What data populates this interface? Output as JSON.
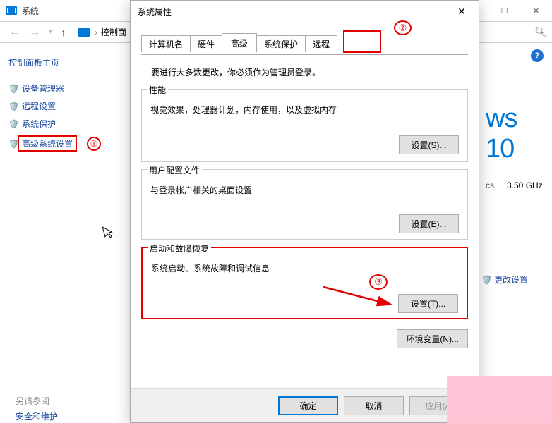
{
  "bg": {
    "title": "系统",
    "breadcrumb": "控制面…",
    "help": "?",
    "wincontrols": {
      "min": "—",
      "max": "☐",
      "close": "✕"
    }
  },
  "leftpanel": {
    "header": "控制面板主页",
    "items": [
      {
        "label": "设备管理器"
      },
      {
        "label": "远程设置"
      },
      {
        "label": "系统保护"
      },
      {
        "label": "高级系统设置"
      }
    ],
    "circle1": "①",
    "see_also": "另请参阅",
    "sec_maint": "安全和维护"
  },
  "right": {
    "win10": "ws 10",
    "cs": "cs",
    "ghz": "3.50 GHz",
    "change": "更改设置"
  },
  "dialog": {
    "title": "系统属性",
    "close": "✕",
    "tabs": [
      "计算机名",
      "硬件",
      "高级",
      "系统保护",
      "远程"
    ],
    "circle2": "②",
    "body": {
      "info": "要进行大多数更改，你必须作为管理员登录。",
      "g1": {
        "title": "性能",
        "desc": "视觉效果，处理器计划，内存使用，以及虚拟内存",
        "btn": "设置(S)..."
      },
      "g2": {
        "title": "用户配置文件",
        "desc": "与登录帐户相关的桌面设置",
        "btn": "设置(E)..."
      },
      "g3": {
        "title": "启动和故障恢复",
        "desc": "系统启动、系统故障和调试信息",
        "btn": "设置(T)...",
        "circle": "③"
      },
      "env_btn": "环境变量(N)..."
    },
    "footer": {
      "ok": "确定",
      "cancel": "取消",
      "apply": "应用(A)"
    }
  }
}
